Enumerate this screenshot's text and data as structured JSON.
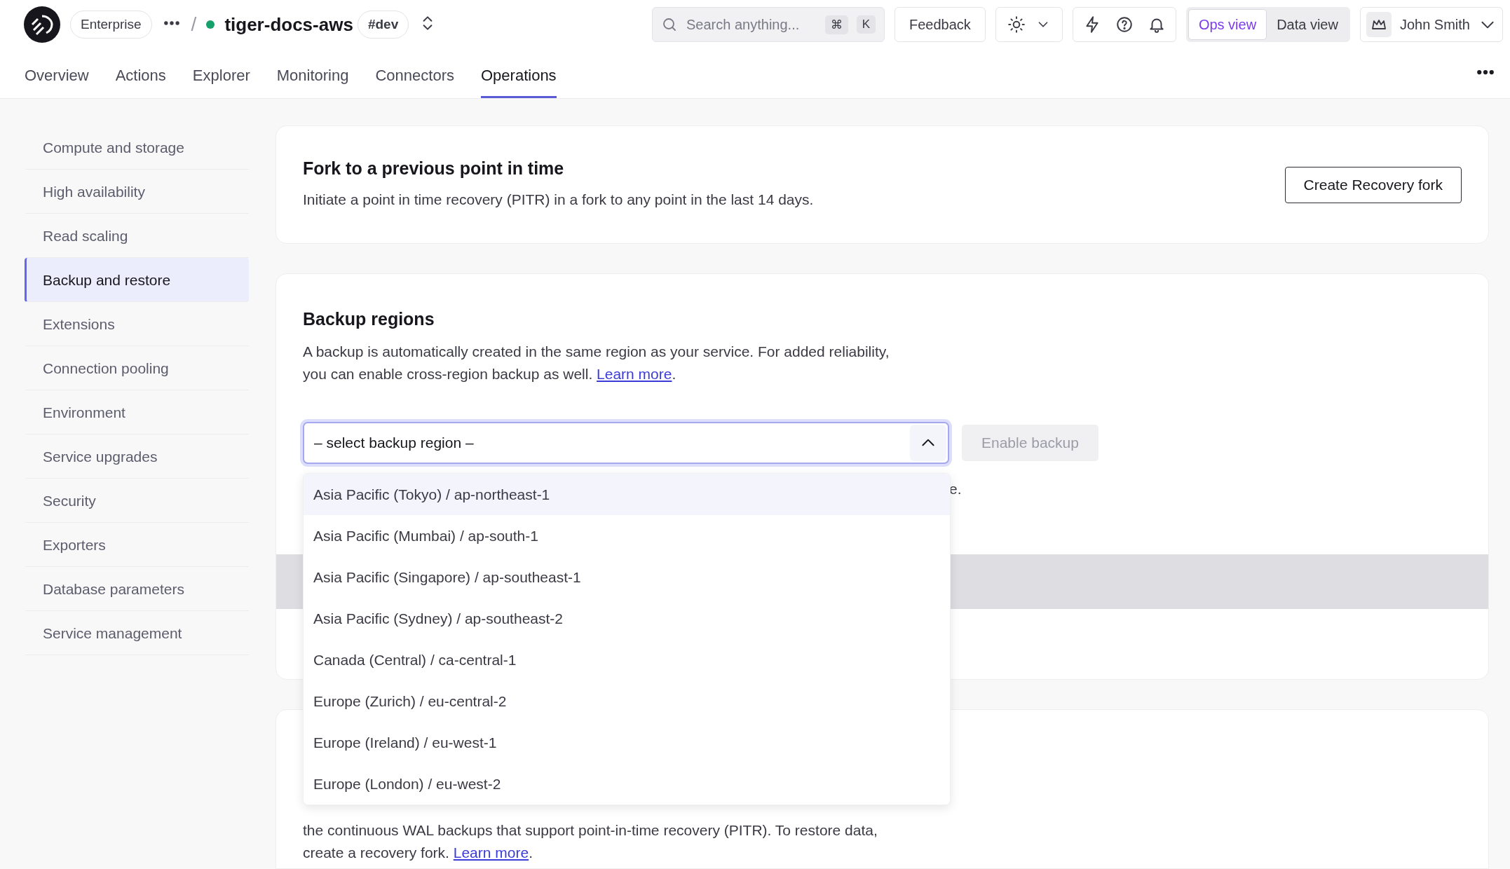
{
  "header": {
    "org": "Enterprise",
    "separator": "/",
    "service": {
      "name": "tiger-docs-aws",
      "tag": "#dev"
    },
    "search": {
      "placeholder": "Search anything...",
      "keys": [
        "⌘",
        "K"
      ]
    },
    "feedback": "Feedback",
    "views": [
      {
        "label": "Ops view",
        "selected": true
      },
      {
        "label": "Data view",
        "selected": false
      }
    ],
    "user": "John Smith"
  },
  "tabs": [
    {
      "label": "Overview",
      "selected": false
    },
    {
      "label": "Actions",
      "selected": false
    },
    {
      "label": "Explorer",
      "selected": false
    },
    {
      "label": "Monitoring",
      "selected": false
    },
    {
      "label": "Connectors",
      "selected": false
    },
    {
      "label": "Operations",
      "selected": true
    }
  ],
  "sidebar": {
    "items": [
      {
        "label": "Compute and storage",
        "selected": false
      },
      {
        "label": "High availability",
        "selected": false
      },
      {
        "label": "Read scaling",
        "selected": false
      },
      {
        "label": "Backup and restore",
        "selected": true
      },
      {
        "label": "Extensions",
        "selected": false
      },
      {
        "label": "Connection pooling",
        "selected": false
      },
      {
        "label": "Environment",
        "selected": false
      },
      {
        "label": "Service upgrades",
        "selected": false
      },
      {
        "label": "Security",
        "selected": false
      },
      {
        "label": "Exporters",
        "selected": false
      },
      {
        "label": "Database parameters",
        "selected": false
      },
      {
        "label": "Service management",
        "selected": false
      }
    ]
  },
  "fork_card": {
    "title": "Fork to a previous point in time",
    "description": "Initiate a point in time recovery (PITR) in a fork to any point in the last 14 days.",
    "button": "Create Recovery fork"
  },
  "backup_card": {
    "title": "Backup regions",
    "description": "A backup is automatically created in the same region as your service. For added reliability, you can enable cross-region backup as well.",
    "link": "Learn more",
    "link_suffix": ".",
    "select": {
      "placeholder": "– select backup region –",
      "expanded": true,
      "options": [
        {
          "label": "Asia Pacific (Tokyo) / ap-northeast-1",
          "highlighted": true
        },
        {
          "label": "Asia Pacific (Mumbai) / ap-south-1",
          "highlighted": false
        },
        {
          "label": "Asia Pacific (Singapore) / ap-southeast-1",
          "highlighted": false
        },
        {
          "label": "Asia Pacific (Sydney) / ap-southeast-2",
          "highlighted": false
        },
        {
          "label": "Canada (Central) / ca-central-1",
          "highlighted": false
        },
        {
          "label": "Europe (Zurich) / eu-central-2",
          "highlighted": false
        },
        {
          "label": "Europe (Ireland) / eu-west-1",
          "highlighted": false
        },
        {
          "label": "Europe (London) / eu-west-2",
          "highlighted": false
        }
      ]
    },
    "enable_button": {
      "label": "Enable backup",
      "disabled": true
    },
    "hint_visible": "e."
  },
  "retention_card": {
    "description": "the continuous WAL backups that support point-in-time recovery (PITR). To restore data, create a recovery fork.",
    "link": "Learn more",
    "link_suffix": "."
  }
}
